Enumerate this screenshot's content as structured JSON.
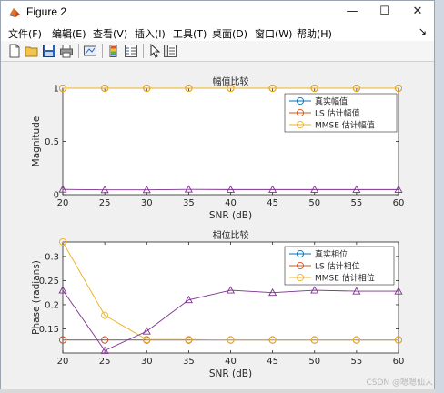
{
  "window": {
    "title": "Figure 2",
    "minimize_glyph": "—",
    "maximize_glyph": "☐",
    "close_glyph": "✕"
  },
  "menu": {
    "items": [
      "文件(F)",
      "编辑(E)",
      "查看(V)",
      "插入(I)",
      "工具(T)",
      "桌面(D)",
      "窗口(W)",
      "帮助(H)"
    ],
    "overflow_glyph": "↘"
  },
  "toolbar": {
    "icons": [
      "new-figure-icon",
      "open-file-icon",
      "save-icon",
      "print-icon",
      "link-plot-icon",
      "insert-colorbar-icon",
      "insert-legend-icon",
      "pointer-icon",
      "property-inspector-icon"
    ]
  },
  "colors": {
    "series_blue": "#0072BD",
    "series_red": "#D95319",
    "series_yellow": "#EDB120",
    "series_purple": "#7E2F8E"
  },
  "watermark": "CSDN @嗯嗯仙人",
  "chart_data": [
    {
      "type": "line",
      "title": "幅值比较",
      "xlabel": "SNR (dB)",
      "ylabel": "Magnitude",
      "x": [
        20,
        25,
        30,
        35,
        40,
        45,
        50,
        55,
        60
      ],
      "xticks": [
        "20",
        "25",
        "30",
        "35",
        "40",
        "45",
        "50",
        "55",
        "60"
      ],
      "yticks": [
        "0",
        "0.5",
        "1"
      ],
      "xlim": [
        20,
        60
      ],
      "ylim": [
        0,
        1
      ],
      "grid": false,
      "legend_position": "top-right",
      "series": [
        {
          "name": "真实幅值",
          "marker": "circle",
          "color": "#0072BD",
          "values": [
            1,
            1,
            1,
            1,
            1,
            1,
            1,
            1,
            1
          ]
        },
        {
          "name": "LS 估计幅值",
          "marker": "circle",
          "color": "#D95319",
          "values": [
            1,
            1,
            1,
            1,
            1,
            1,
            1,
            1,
            1
          ]
        },
        {
          "name": "MMSE 估计幅值",
          "marker": "circle",
          "color": "#EDB120",
          "values": [
            1,
            1,
            1,
            1,
            1,
            1,
            1,
            1,
            1
          ]
        },
        {
          "name": "",
          "marker": "triangle",
          "color": "#7E2F8E",
          "values": [
            0.05,
            0.045,
            0.045,
            0.05,
            0.048,
            0.048,
            0.048,
            0.048,
            0.048
          ]
        }
      ]
    },
    {
      "type": "line",
      "title": "相位比较",
      "xlabel": "SNR (dB)",
      "ylabel": "Phase (radians)",
      "x": [
        20,
        25,
        30,
        35,
        40,
        45,
        50,
        55,
        60
      ],
      "xticks": [
        "20",
        "25",
        "30",
        "35",
        "40",
        "45",
        "50",
        "55",
        "60"
      ],
      "yticks": [
        "0.15",
        "0.2",
        "0.25",
        "0.3"
      ],
      "xlim": [
        20,
        60
      ],
      "ylim": [
        0.1,
        0.33
      ],
      "grid": false,
      "legend_position": "top-right",
      "series": [
        {
          "name": "真实相位",
          "marker": "circle",
          "color": "#0072BD",
          "values": [
            0.127,
            0.127,
            0.127,
            0.127,
            0.127,
            0.127,
            0.127,
            0.127,
            0.127
          ]
        },
        {
          "name": "LS 估计相位",
          "marker": "circle",
          "color": "#D95319",
          "values": [
            0.127,
            0.127,
            0.127,
            0.127,
            0.127,
            0.127,
            0.127,
            0.127,
            0.127
          ]
        },
        {
          "name": "MMSE 估计相位",
          "marker": "circle",
          "color": "#EDB120",
          "values": [
            0.33,
            0.178,
            0.128,
            0.128,
            0.127,
            0.127,
            0.127,
            0.127,
            0.127
          ]
        },
        {
          "name": "",
          "marker": "triangle",
          "color": "#7E2F8E",
          "values": [
            0.23,
            0.105,
            0.145,
            0.21,
            0.23,
            0.225,
            0.23,
            0.228,
            0.228
          ]
        }
      ]
    }
  ]
}
